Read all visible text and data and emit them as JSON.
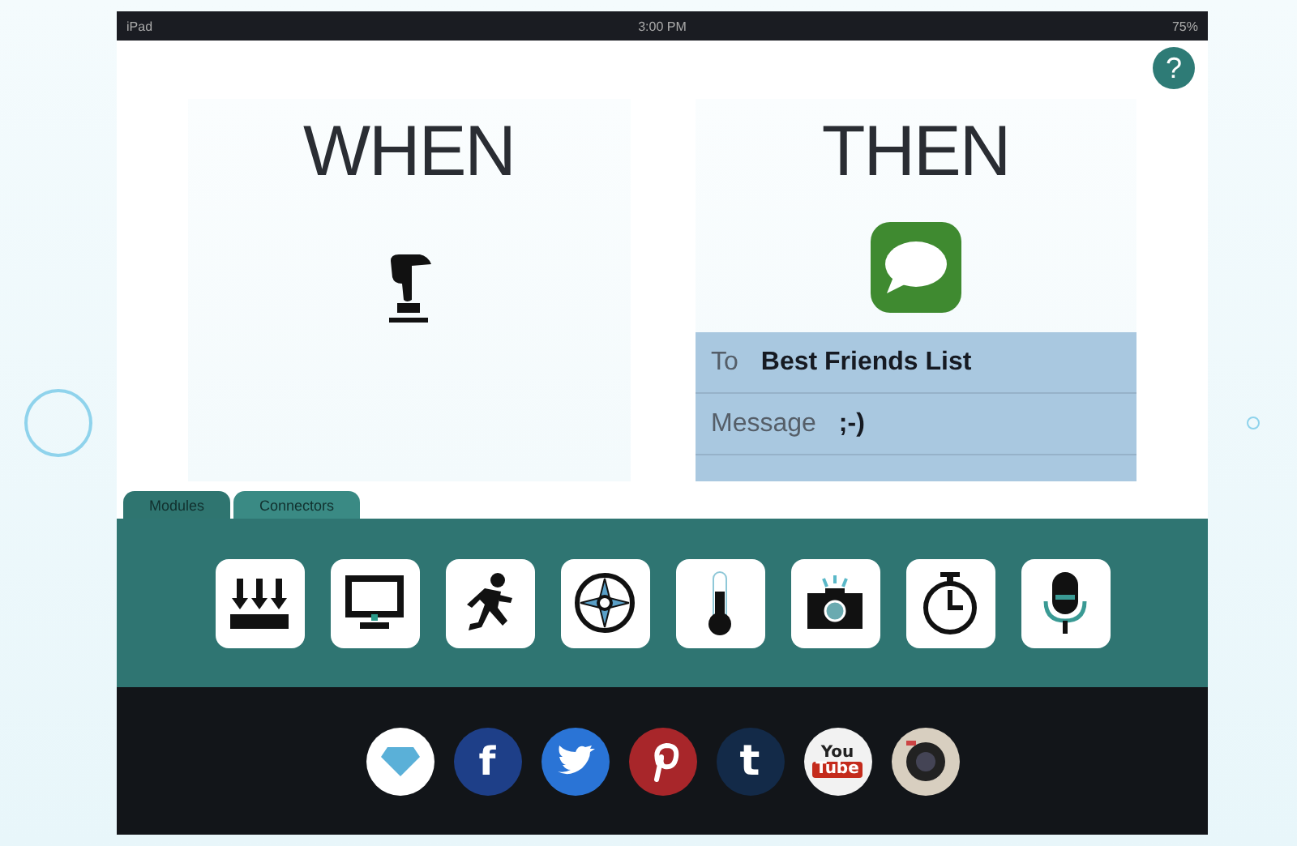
{
  "status_bar": {
    "device": "iPad",
    "time": "3:00 PM",
    "battery": "75%"
  },
  "help": {
    "label": "?"
  },
  "when": {
    "title": "WHEN"
  },
  "then": {
    "title": "THEN",
    "fields": [
      {
        "label": "To",
        "value": "Best Friends List"
      },
      {
        "label": "Message",
        "value": ";-)"
      }
    ]
  },
  "tabs": [
    {
      "label": "Modules",
      "selected": true
    },
    {
      "label": "Connectors",
      "selected": false
    }
  ],
  "modules": [
    {
      "kind": "press"
    },
    {
      "kind": "display"
    },
    {
      "kind": "motion"
    },
    {
      "kind": "compass"
    },
    {
      "kind": "temperature"
    },
    {
      "kind": "camera"
    },
    {
      "kind": "timer"
    },
    {
      "kind": "microphone"
    }
  ],
  "social": [
    {
      "kind": "diamond"
    },
    {
      "kind": "facebook",
      "glyph": "f"
    },
    {
      "kind": "twitter"
    },
    {
      "kind": "pinterest"
    },
    {
      "kind": "tumblr",
      "glyph": "t"
    },
    {
      "kind": "youtube",
      "glyph": "You",
      "glyph2": "Tube"
    },
    {
      "kind": "camera"
    }
  ]
}
